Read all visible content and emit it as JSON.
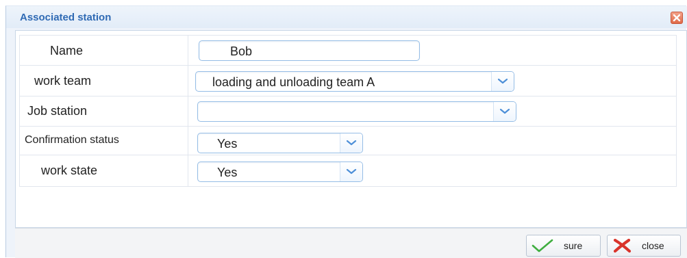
{
  "dialog": {
    "title": "Associated station"
  },
  "form": {
    "rows": [
      {
        "label": "Name",
        "value": "Bob"
      },
      {
        "label": "work team",
        "value": "loading and unloading team A"
      },
      {
        "label": "Job station",
        "value": ""
      },
      {
        "label": "Confirmation status",
        "value": "Yes"
      },
      {
        "label": "work state",
        "value": "Yes"
      }
    ]
  },
  "footer": {
    "sure_label": "sure",
    "close_label": "close"
  },
  "icons": {
    "title_close": "close-x-icon",
    "dropdown": "chevron-down-icon",
    "sure": "checkmark-icon",
    "close": "red-x-icon"
  },
  "colors": {
    "title_text": "#2f6ab4",
    "field_border": "#95bde6",
    "sure_check": "#3fae3f",
    "close_x": "#d9342b"
  }
}
